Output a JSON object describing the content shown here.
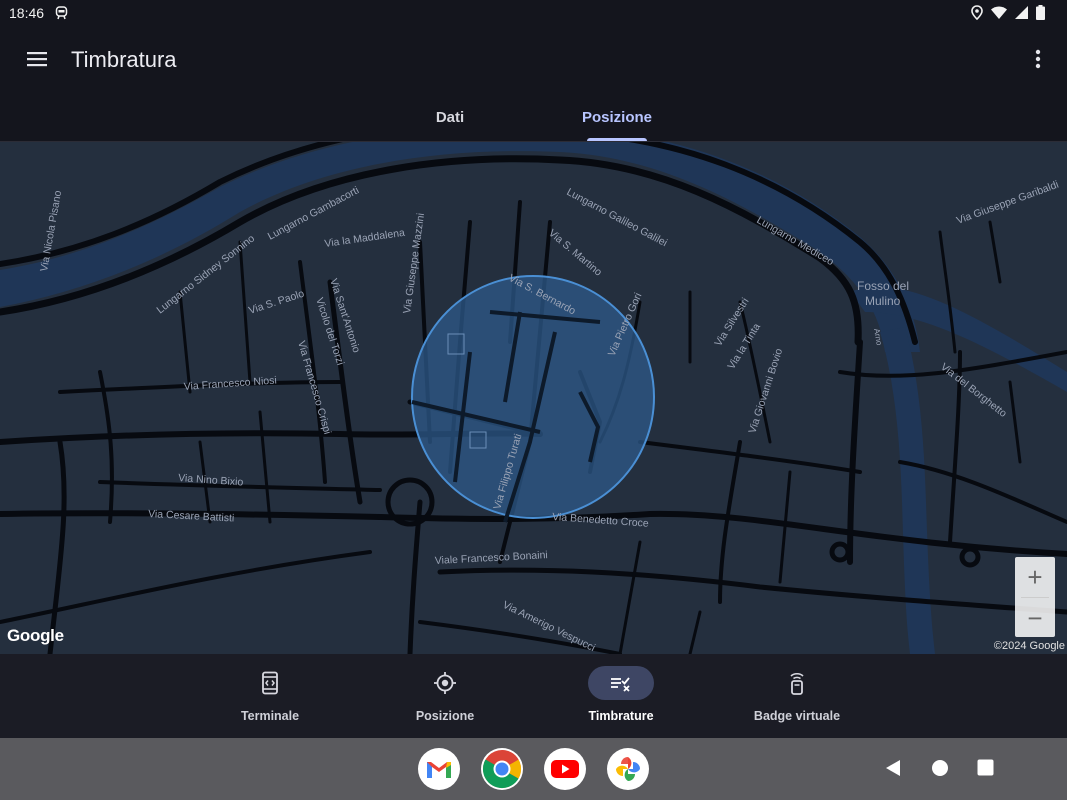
{
  "status": {
    "time": "18:46"
  },
  "appbar": {
    "title": "Timbratura"
  },
  "tabs": [
    {
      "label": "Dati",
      "active": false
    },
    {
      "label": "Posizione",
      "active": true
    }
  ],
  "map": {
    "streets": [
      "Via Nicola Pisano",
      "Lungarno Gambacorti",
      "Via la Maddalena",
      "Lungarno Sidney Sonnino",
      "Via S. Paolo",
      "Via Sant'Antonio",
      "Vicolo del Torzi",
      "Via Giuseppe Mazzini",
      "Via S. Martino",
      "Lungarno Galileo Galilei",
      "Lungarno Mediceo",
      "Via Giuseppe Garibaldi",
      "Via S. Bernardo",
      "Via Pietro Gori",
      "Via Silvestri",
      "Via la Tinta",
      "Via Giovanni Bovio",
      "Via del Borghetto",
      "Via Francesco Crispi",
      "Via Francesco Niosi",
      "Via Nino Bixio",
      "Via Cesare Battisti",
      "Via Filippo Turati",
      "Via Benedetto Croce",
      "Viale Francesco Bonaini",
      "Via Amerigo Vespucci"
    ],
    "area_label_1": "Fosso del",
    "area_label_2": "Mulino",
    "river_label": "Arno",
    "logo": "Google",
    "copyright": "©2024 Google",
    "zoom_in": "+",
    "zoom_out": "−"
  },
  "bottom_nav": [
    {
      "label": "Terminale",
      "icon": "terminal-icon",
      "active": false
    },
    {
      "label": "Posizione",
      "icon": "location-target-icon",
      "active": false
    },
    {
      "label": "Timbrature",
      "icon": "list-check-icon",
      "active": true
    },
    {
      "label": "Badge virtuale",
      "icon": "badge-nfc-icon",
      "active": false
    }
  ],
  "dock": [
    {
      "icon": "gmail-icon"
    },
    {
      "icon": "chrome-icon"
    },
    {
      "icon": "youtube-icon"
    },
    {
      "icon": "google-photos-icon"
    }
  ],
  "colors": {
    "background": "#14151d",
    "map_bg": "#242f3e",
    "water": "#1f3657",
    "accent": "#b8c5ff",
    "circle_fill": "#2d5a8a",
    "circle_stroke": "#4a8fd4"
  }
}
